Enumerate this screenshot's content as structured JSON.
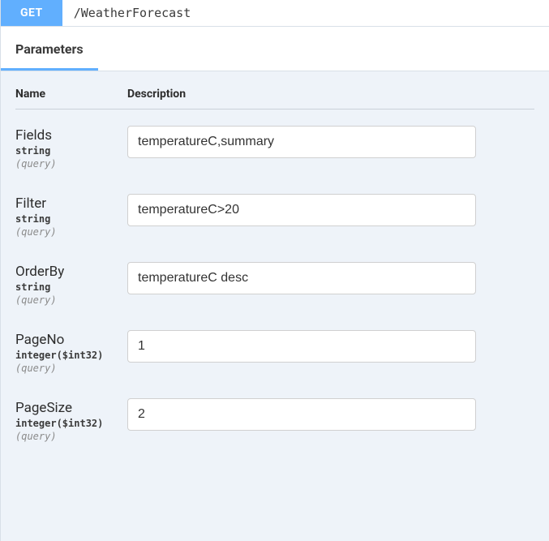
{
  "operation": {
    "method": "GET",
    "path": "/WeatherForecast"
  },
  "tabs": {
    "parameters": "Parameters"
  },
  "columns": {
    "name": "Name",
    "description": "Description"
  },
  "params": [
    {
      "name": "Fields",
      "type": "string",
      "in": "(query)",
      "value": "temperatureC,summary"
    },
    {
      "name": "Filter",
      "type": "string",
      "in": "(query)",
      "value": "temperatureC>20"
    },
    {
      "name": "OrderBy",
      "type": "string",
      "in": "(query)",
      "value": "temperatureC desc"
    },
    {
      "name": "PageNo",
      "type": "integer($int32)",
      "in": "(query)",
      "value": "1"
    },
    {
      "name": "PageSize",
      "type": "integer($int32)",
      "in": "(query)",
      "value": "2"
    }
  ]
}
